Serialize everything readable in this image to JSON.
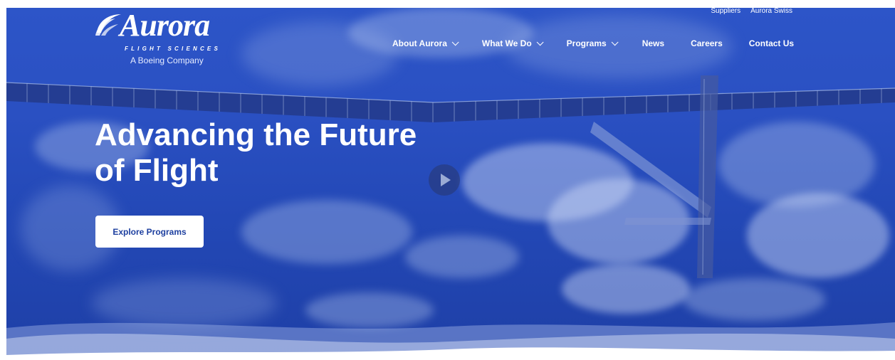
{
  "brand": {
    "name": "Aurora",
    "subtitle": "FLIGHT SCIENCES",
    "tagline": "A Boeing Company"
  },
  "utility_links": [
    {
      "label": "Suppliers"
    },
    {
      "label": "Aurora Swiss"
    }
  ],
  "nav": {
    "items": [
      {
        "label": "About Aurora",
        "has_dropdown": true
      },
      {
        "label": "What We Do",
        "has_dropdown": true
      },
      {
        "label": "Programs",
        "has_dropdown": true
      },
      {
        "label": "News",
        "has_dropdown": false
      },
      {
        "label": "Careers",
        "has_dropdown": false
      },
      {
        "label": "Contact Us",
        "has_dropdown": false
      }
    ]
  },
  "hero": {
    "headline_line1": "Advancing the Future",
    "headline_line2": "of Flight",
    "cta_label": "Explore Programs",
    "play_icon": "play-icon"
  },
  "colors": {
    "hero_blue": "#2a50c2",
    "cta_text": "#1d3f9f",
    "text_white": "#ffffff"
  }
}
